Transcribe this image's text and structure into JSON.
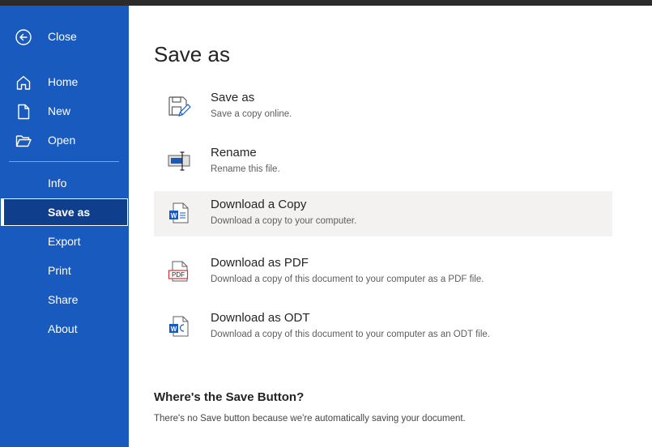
{
  "sidebar": {
    "close_label": "Close",
    "items": [
      {
        "label": "Home",
        "icon": "home-icon"
      },
      {
        "label": "New",
        "icon": "new-document-icon"
      },
      {
        "label": "Open",
        "icon": "folder-open-icon"
      },
      {
        "label": "Info"
      },
      {
        "label": "Save as",
        "selected": true
      },
      {
        "label": "Export"
      },
      {
        "label": "Print"
      },
      {
        "label": "Share"
      },
      {
        "label": "About"
      }
    ]
  },
  "main": {
    "title": "Save as",
    "options": [
      {
        "title": "Save as",
        "description": "Save a copy online.",
        "icon": "save-as-icon"
      },
      {
        "title": "Rename",
        "description": "Rename this file.",
        "icon": "rename-icon"
      },
      {
        "title": "Download a Copy",
        "description": "Download a copy to your computer.",
        "icon": "word-document-icon",
        "highlighted": true
      },
      {
        "title": "Download as PDF",
        "description": "Download a copy of this document to your computer as a PDF file.",
        "icon": "pdf-icon",
        "icon_text": "PDF"
      },
      {
        "title": "Download as ODT",
        "description": "Download a copy of this document to your computer as an ODT file.",
        "icon": "odt-document-icon"
      }
    ],
    "help": {
      "heading": "Where's the Save Button?",
      "text": "There's no Save button because we're automatically saving your document."
    }
  },
  "colors": {
    "sidebar_bg": "#185abd",
    "selected_bg": "#0f3e8c",
    "highlight_bg": "#f3f2f1",
    "word_blue": "#185abd",
    "pdf_red": "#d13438"
  }
}
